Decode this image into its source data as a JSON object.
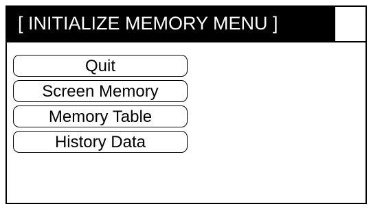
{
  "header": {
    "title": "[ INITIALIZE MEMORY MENU ]"
  },
  "menu": {
    "items": [
      {
        "label": "Quit"
      },
      {
        "label": "Screen Memory"
      },
      {
        "label": "Memory Table"
      },
      {
        "label": "History Data"
      }
    ]
  },
  "colors": {
    "title_background": "#000000",
    "title_text": "#ffffff",
    "button_border": "#000000",
    "button_background": "#ffffff"
  }
}
